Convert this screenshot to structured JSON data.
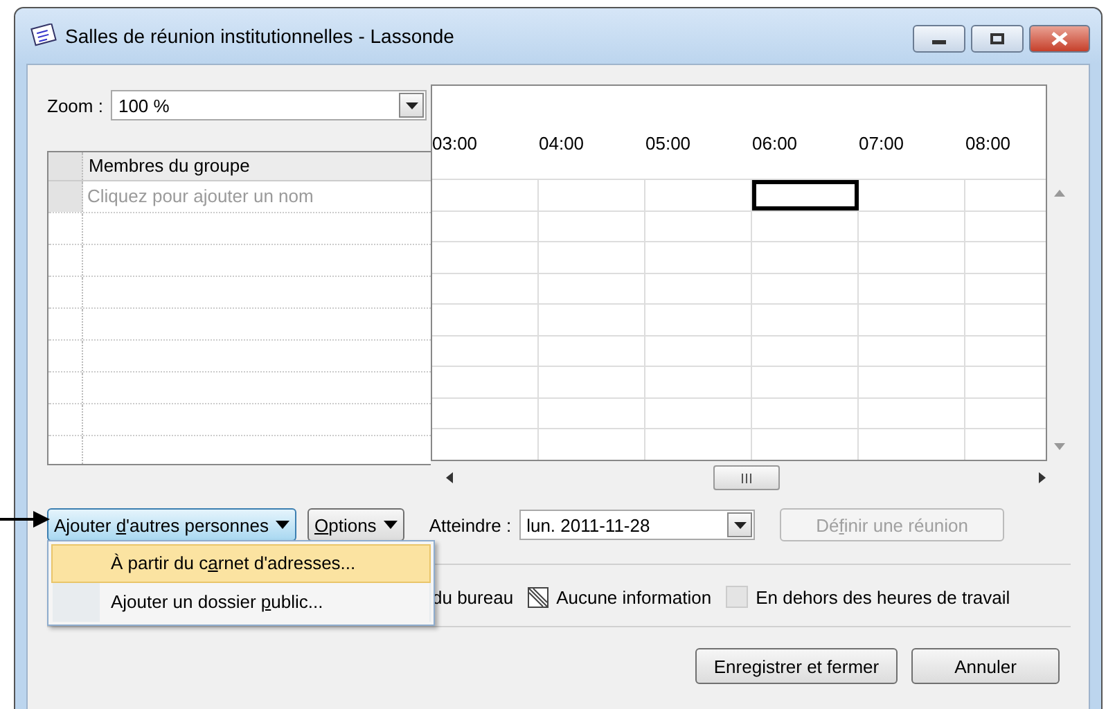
{
  "window": {
    "title": "Salles de réunion institutionnelles - Lassonde"
  },
  "zoom": {
    "label": "Zoom :",
    "value": "100 %"
  },
  "members": {
    "header": "Membres du groupe",
    "placeholder": "Cliquez pour ajouter un nom"
  },
  "timeline": {
    "hours": [
      "03:00",
      "04:00",
      "05:00",
      "06:00",
      "07:00",
      "08:00"
    ]
  },
  "add_button": {
    "pre": "Ajouter ",
    "key": "d",
    "post": "'autres personnes"
  },
  "options_button": {
    "key": "O",
    "post": "ptions"
  },
  "goto": {
    "label": "Atteindre :",
    "value": "lun. 2011-11-28"
  },
  "define_button": {
    "pre": "Dé",
    "key": "f",
    "post": "inir une réunion",
    "disabled": true
  },
  "menu": [
    {
      "pre": "À partir du c",
      "key": "a",
      "post": "rnet d'adresses...",
      "selected": true
    },
    {
      "pre": "Ajouter un dossier ",
      "key": "p",
      "post": "ublic...",
      "selected": false
    }
  ],
  "legend": [
    {
      "kind": "plain",
      "label": "du bureau"
    },
    {
      "kind": "hatched",
      "label": "Aucune information"
    },
    {
      "kind": "grey",
      "label": "En dehors des heures de travail"
    }
  ],
  "footer": [
    "Enregistrer et fermer",
    "Annuler"
  ]
}
